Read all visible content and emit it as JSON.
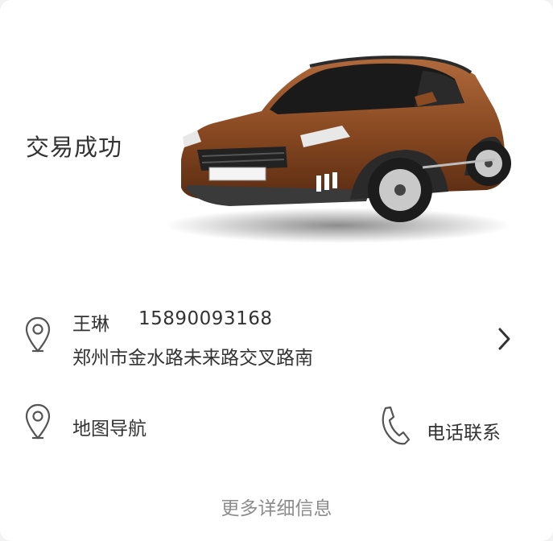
{
  "order": {
    "status": "交易成功"
  },
  "contact": {
    "name": "王琳",
    "phone": "15890093168",
    "address": "郑州市金水路未来路交叉路南"
  },
  "actions": {
    "map_nav_label": "地图导航",
    "call_label": "电话联系"
  },
  "footer": {
    "more_info": "更多详细信息"
  },
  "icons": {
    "location": "location-pin-icon",
    "chevron": "chevron-right-icon",
    "phone": "phone-handset-icon"
  },
  "colors": {
    "text_primary": "#333333",
    "text_muted": "#8c8c8c",
    "icon": "#555555",
    "car_body": "#8a4a22"
  }
}
